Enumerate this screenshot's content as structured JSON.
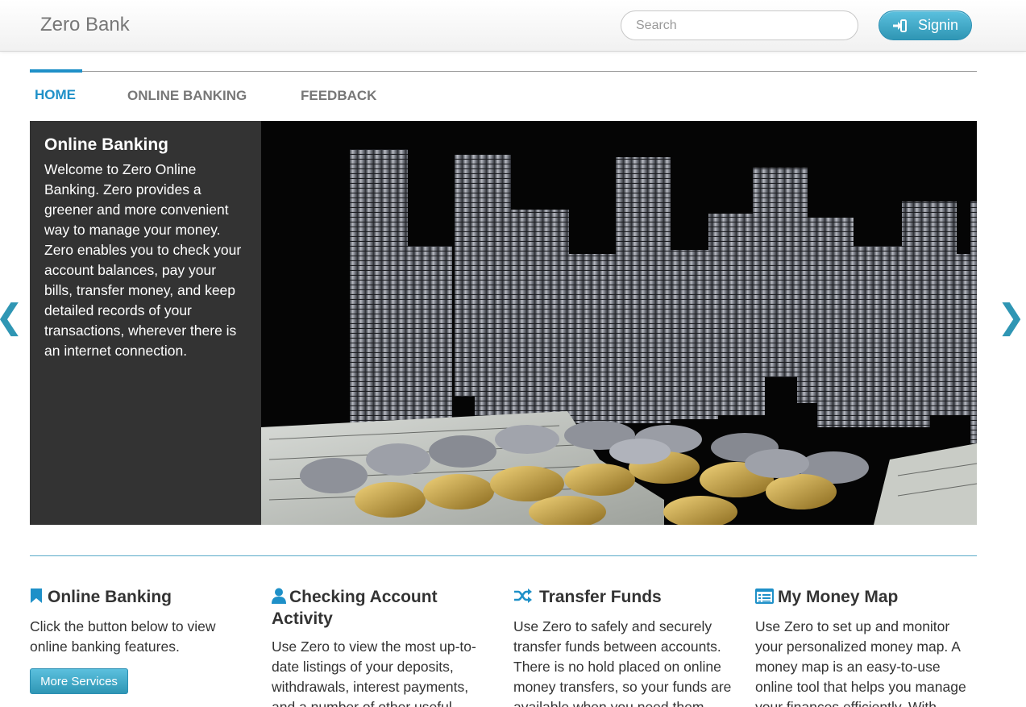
{
  "header": {
    "brand": "Zero Bank",
    "search_placeholder": "Search",
    "signin_label": "Signin"
  },
  "nav": {
    "tabs": [
      {
        "label": "HOME",
        "active": true
      },
      {
        "label": "ONLINE BANKING",
        "active": false
      },
      {
        "label": "FEEDBACK",
        "active": false
      }
    ]
  },
  "carousel": {
    "title": "Online Banking",
    "text": "Welcome to Zero Online Banking. Zero provides a greener and more convenient way to manage your money. Zero enables you to check your account balances, pay your bills, transfer money, and keep detailed records of your transactions, wherever there is an internet connection.",
    "prev_icon": "chevron-left-icon",
    "next_icon": "chevron-right-icon"
  },
  "features": [
    {
      "icon": "bookmark-icon",
      "title": "Online Banking",
      "text": "Click the button below to view online banking features.",
      "button": "More Services"
    },
    {
      "icon": "user-icon",
      "title": "Checking Account Activity",
      "text": "Use Zero to view the most up-to-date listings of your deposits, withdrawals, interest payments, and a number of other useful"
    },
    {
      "icon": "shuffle-icon",
      "title": "Transfer Funds",
      "text": "Use Zero to safely and securely transfer funds between accounts. There is no hold placed on online money transfers, so your funds are available when you need them."
    },
    {
      "icon": "list-icon",
      "title": "My Money Map",
      "text": "Use Zero to set up and monitor your personalized money map. A money map is an easy-to-use online tool that helps you manage your finances efficiently. With"
    }
  ],
  "colors": {
    "accent": "#1e90c8",
    "button": "#2f96b4",
    "caption_bg": "#333333"
  }
}
